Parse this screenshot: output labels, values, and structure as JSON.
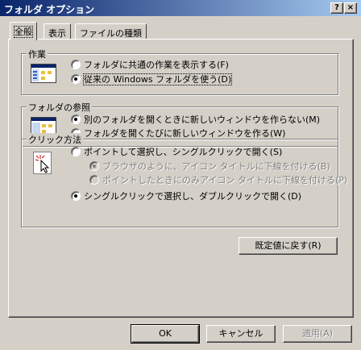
{
  "window": {
    "title": "フォルダ オプション",
    "help_button": "?",
    "close_button": "×"
  },
  "tabs": [
    {
      "label": "全般"
    },
    {
      "label": "表示"
    },
    {
      "label": "ファイルの種類"
    }
  ],
  "groups": {
    "tasks": {
      "legend": "作業",
      "options": [
        {
          "label": "フォルダに共通の作業を表示する(F)",
          "checked": false
        },
        {
          "label": "従来の Windows フォルダを使う(D)",
          "checked": true
        }
      ]
    },
    "browse": {
      "legend": "フォルダの参照",
      "options": [
        {
          "label": "別のフォルダを開くときに新しいウィンドウを作らない(M)",
          "checked": true
        },
        {
          "label": "フォルダを開くたびに新しいウィンドウを作る(W)",
          "checked": false
        }
      ]
    },
    "click": {
      "legend": "クリック方法",
      "options": [
        {
          "label": "ポイントして選択し、シングルクリックで開く(S)",
          "checked": false
        },
        {
          "label": "ブラウザのように、アイコン タイトルに下線を付ける(B)",
          "checked": true,
          "disabled": true
        },
        {
          "label": "ポイントしたときにのみアイコン タイトルに下線を付ける(P)",
          "checked": false,
          "disabled": true
        },
        {
          "label": "シングルクリックで選択し、ダブルクリックで開く(D)",
          "checked": true
        }
      ]
    }
  },
  "restore_defaults": "既定値に戻す(R)",
  "footer": {
    "ok": "OK",
    "cancel": "キャンセル",
    "apply": "適用(A)"
  }
}
